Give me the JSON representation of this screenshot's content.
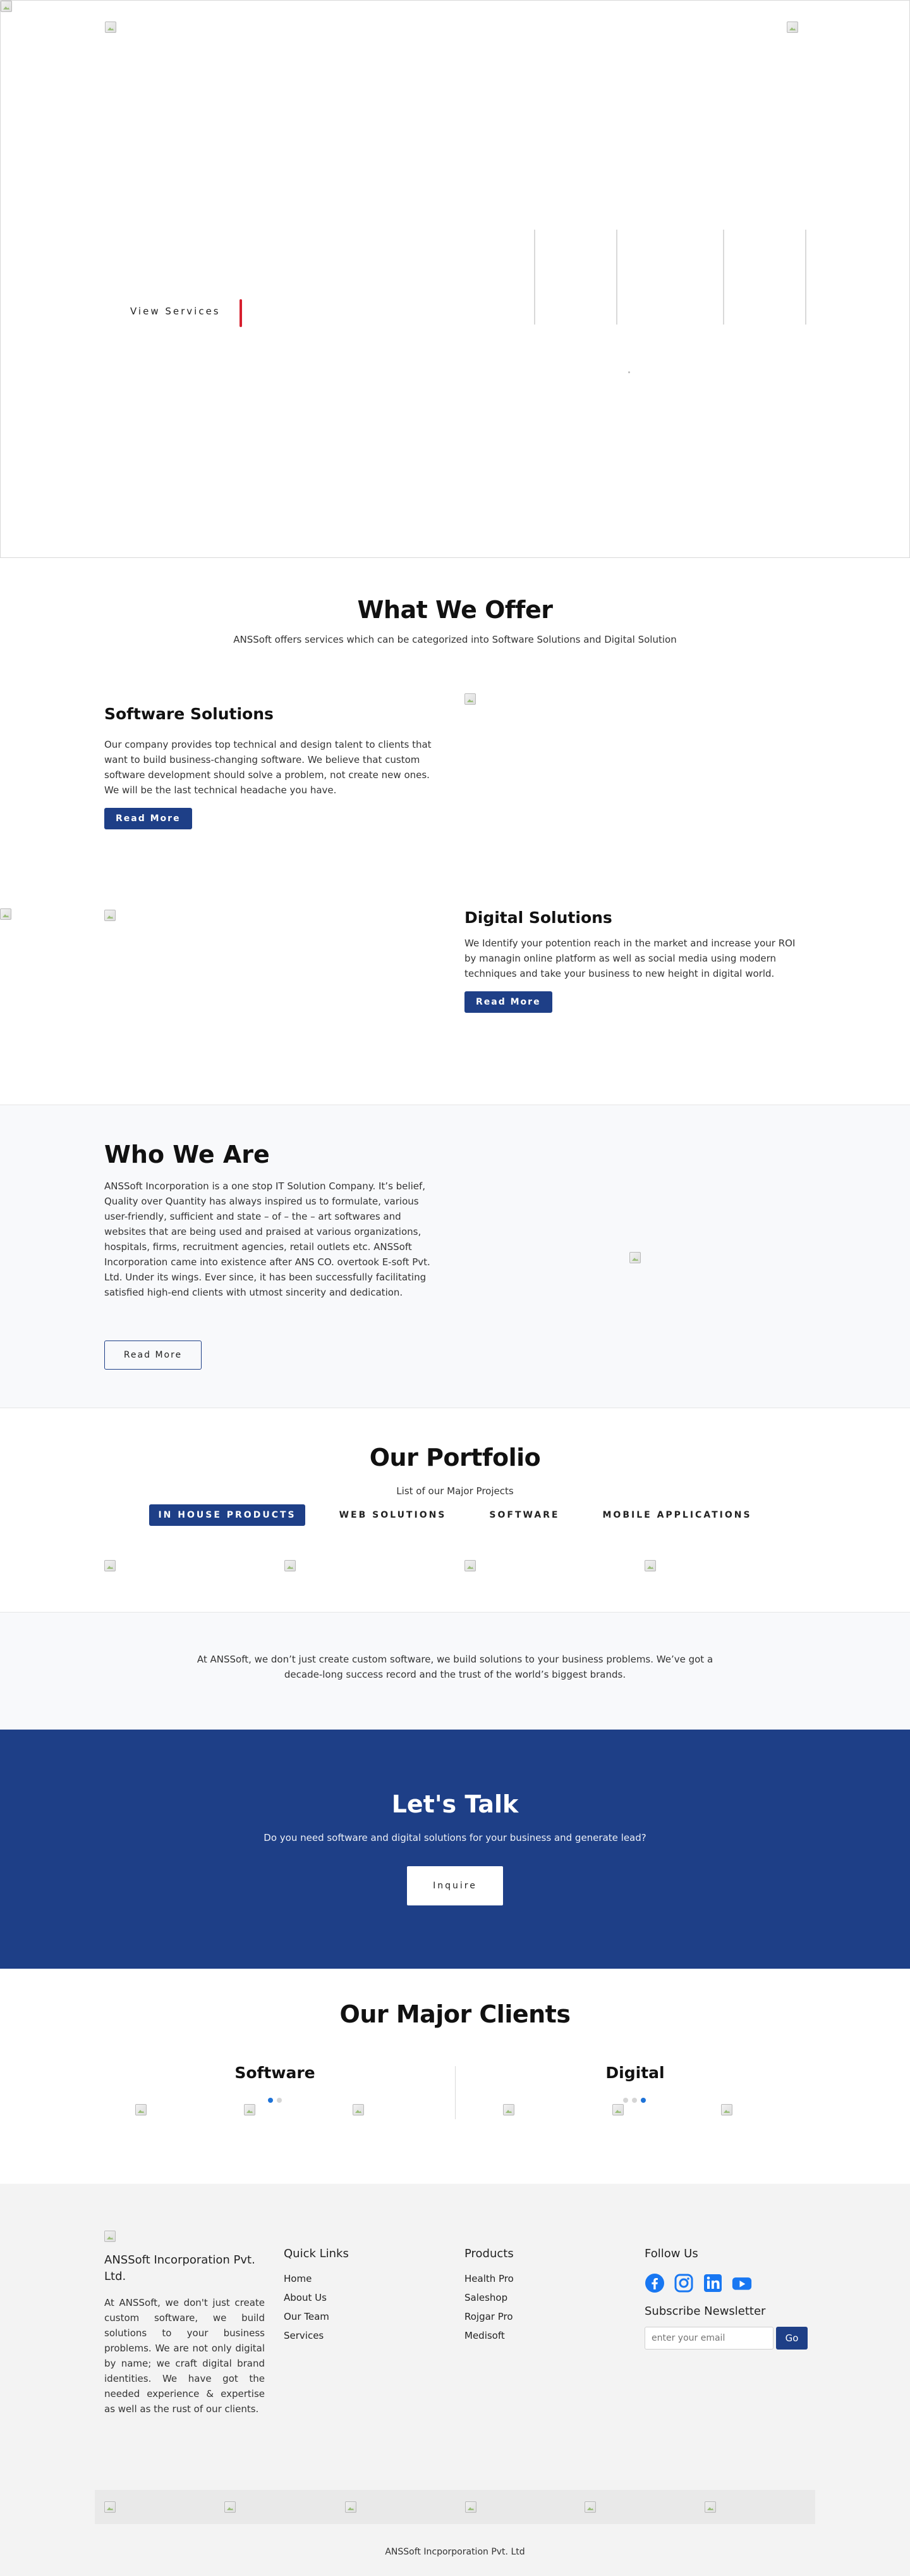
{
  "hero": {
    "view_services_label": "View Services"
  },
  "offer": {
    "title": "What We Offer",
    "subtitle": "ANSSoft offers services which can be categorized into Software Solutions and Digital Solution",
    "software": {
      "title": "Software Solutions",
      "body": "Our company provides top technical and design talent to clients that want to build business-changing software. We believe that custom software development should solve a problem, not create new ones. We will be the last technical headache you have.",
      "button": "Read More"
    },
    "digital": {
      "title": "Digital Solutions",
      "body": "We Identify your potention reach in the market and increase your ROI by managin online platform as well as social media using modern techniques and take your business to new height in digital world.",
      "button": "Read More"
    }
  },
  "who": {
    "title": "Who We Are",
    "body": "ANSSoft Incorporation is a one stop IT Solution Company. It’s belief, Quality over Quantity has always inspired us to formulate, various user-friendly, sufficient and state – of – the – art softwares and websites that are being used and praised at various organizations, hospitals, firms, recruitment agencies, retail outlets etc. ANSSoft Incorporation came into existence after ANS CO. overtook E-soft Pvt. Ltd. Under its wings. Ever since, it has been successfully facilitating satisfied high-end clients with utmost sincerity and dedication.",
    "button": "Read More"
  },
  "portfolio": {
    "title": "Our Portfolio",
    "subtitle": "List of our Major Projects",
    "tabs": [
      "IN HOUSE PRODUCTS",
      "WEB SOLUTIONS",
      "SOFTWARE",
      "MOBILE APPLICATIONS"
    ],
    "active_tab": "IN HOUSE PRODUCTS"
  },
  "band": {
    "text": "At ANSSoft, we don’t just create custom software, we build solutions to your business problems. We’ve got a decade-long success record and the trust of the world’s biggest brands."
  },
  "talk": {
    "title": "Let's Talk",
    "subtitle": "Do you need software and digital solutions for your business and generate lead?",
    "button": "Inquire"
  },
  "clients": {
    "title": "Our Major Clients",
    "software_title": "Software",
    "digital_title": "Digital"
  },
  "footer": {
    "brand_name": "ANSSoft Incorporation Pvt. Ltd.",
    "brand_desc": "At ANSSoft, we don't just create custom software, we build solutions to your business problems. We are not only digital by name; we craft digital brand identities. We have got the needed experience & expertise as well as the rust of our clients.",
    "quick_links_title": "Quick Links",
    "quick_links": [
      "Home",
      "About Us",
      "Our Team",
      "Services"
    ],
    "products_title": "Products",
    "products": [
      "Health Pro",
      "Saleshop",
      "Rojgar Pro",
      "Medisoft"
    ],
    "follow_title": "Follow Us",
    "socials": [
      "facebook-icon",
      "instagram-icon",
      "linkedin-icon",
      "youtube-icon"
    ],
    "newsletter_title": "Subscribe Newsletter",
    "newsletter_placeholder": "enter your email",
    "newsletter_button": "Go",
    "copyright": "ANSSoft Incporporation Pvt. Ltd"
  },
  "colors": {
    "brand_blue": "#1e3f87",
    "accent_red": "#d71f2e",
    "social_blue": "#1877f2"
  }
}
